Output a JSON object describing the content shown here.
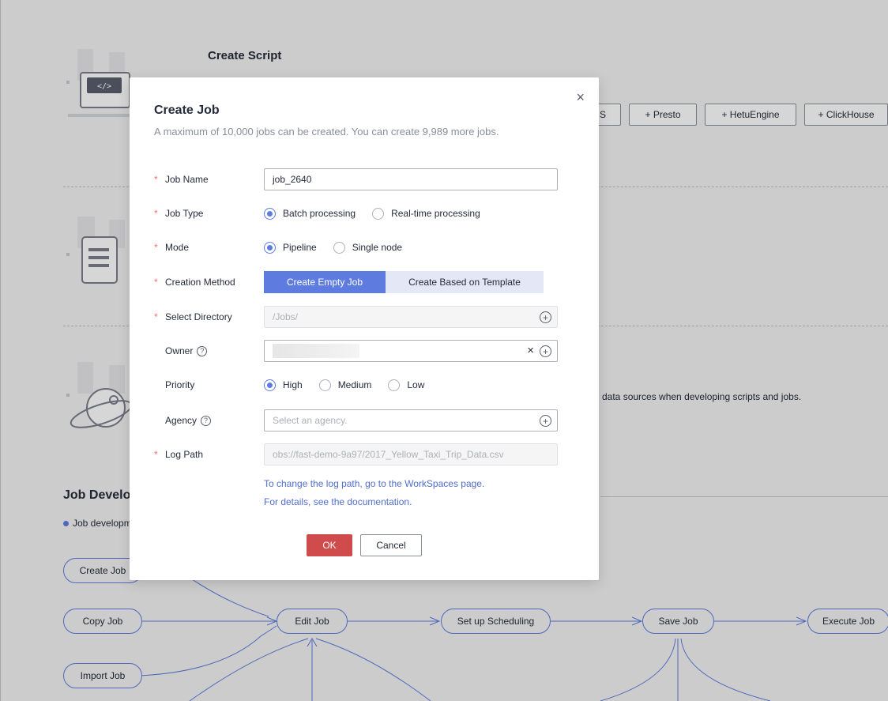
{
  "background": {
    "create_script_title": "Create Script",
    "script_buttons": [
      "S",
      "+ Presto",
      "+ HetuEngine",
      "+ ClickHouse"
    ],
    "data_source_desc": "data sources when developing scripts and jobs.",
    "job_dev_title": "Job Develo",
    "job_dev_bullet": "Job developm",
    "flow_nodes": {
      "create_job": "Create Job",
      "copy_job": "Copy Job",
      "import_job": "Import Job",
      "edit_job": "Edit Job",
      "setup_scheduling": "Set up Scheduling",
      "save_job": "Save Job",
      "execute_job": "Execute Job"
    }
  },
  "modal": {
    "title": "Create Job",
    "subtitle": "A maximum of 10,000 jobs can be created. You can create 9,989 more jobs.",
    "close_symbol": "×",
    "required_mark": "*",
    "fields": {
      "job_name": {
        "label": "Job Name",
        "value": "job_2640"
      },
      "job_type": {
        "label": "Job Type",
        "options": [
          "Batch processing",
          "Real-time processing"
        ],
        "selected": "Batch processing"
      },
      "mode": {
        "label": "Mode",
        "options": [
          "Pipeline",
          "Single node"
        ],
        "selected": "Pipeline"
      },
      "creation_method": {
        "label": "Creation Method",
        "options": [
          "Create Empty Job",
          "Create Based on Template"
        ],
        "selected": "Create Empty Job"
      },
      "select_directory": {
        "label": "Select Directory",
        "value": "/Jobs/"
      },
      "owner": {
        "label": "Owner",
        "help": "?"
      },
      "priority": {
        "label": "Priority",
        "options": [
          "High",
          "Medium",
          "Low"
        ],
        "selected": "High"
      },
      "agency": {
        "label": "Agency",
        "help": "?",
        "placeholder": "Select an agency."
      },
      "log_path": {
        "label": "Log Path",
        "value": "obs://fast-demo-9a97/2017_Yellow_Taxi_Trip_Data.csv"
      }
    },
    "links": {
      "change_log_path": "To change the log path, go to the WorkSpaces page.",
      "docs": "For details, see the documentation."
    },
    "buttons": {
      "ok": "OK",
      "cancel": "Cancel"
    }
  },
  "colors": {
    "primary": "#5e7ce0",
    "danger": "#d04b4b",
    "required": "#f66f6a",
    "link": "#526ecc"
  }
}
